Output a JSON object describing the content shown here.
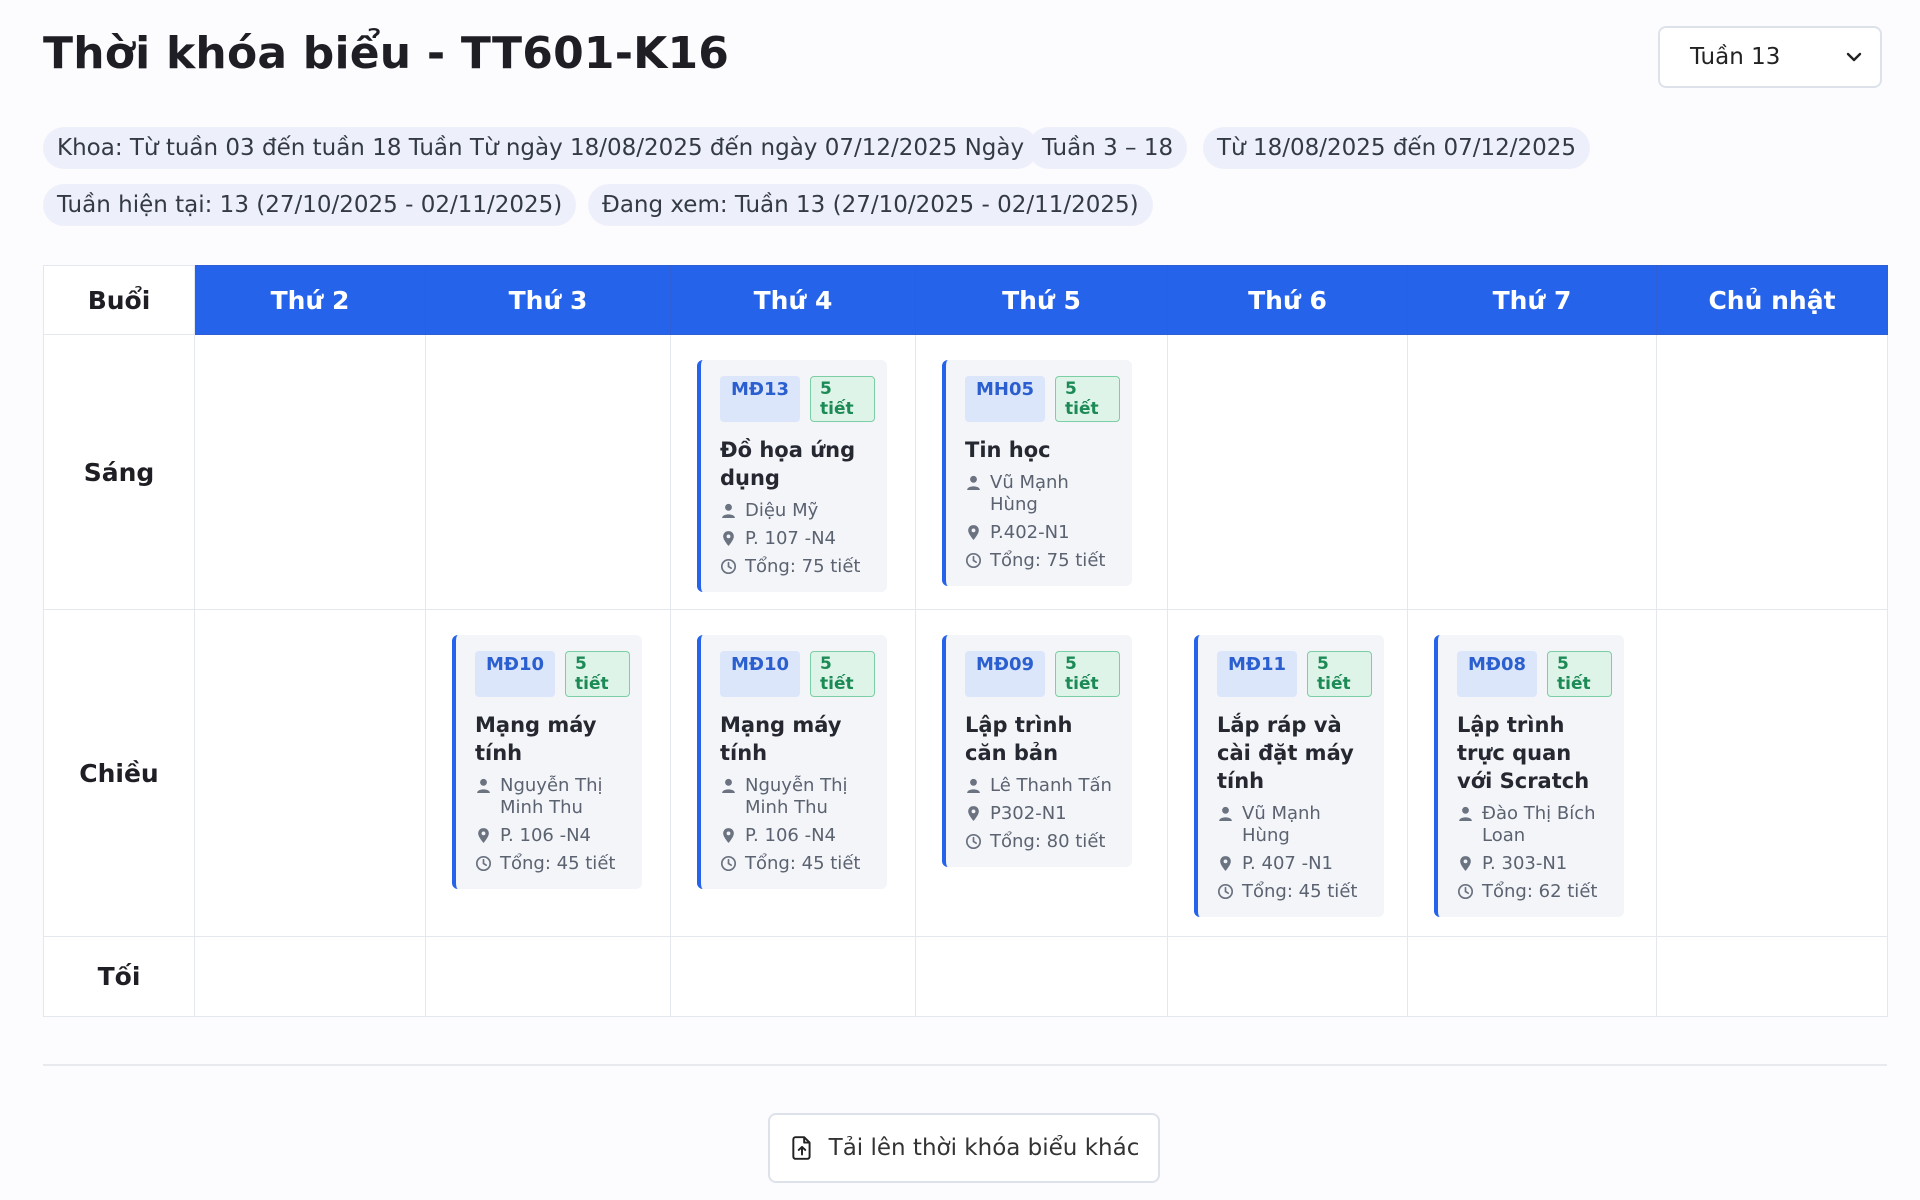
{
  "header": {
    "title": "Thời khóa biểu - TT601-K16",
    "week_select": "Tuần 13"
  },
  "info_pills": [
    "Khoa: Từ tuần 03 đến tuần 18 Tuần Từ ngày 18/08/2025 đến ngày 07/12/2025 Ngày",
    "Tuần 3 – 18",
    "Từ 18/08/2025 đến 07/12/2025",
    "Tuần hiện tại: 13 (27/10/2025 - 02/11/2025)",
    "Đang xem: Tuần 13 (27/10/2025 - 02/11/2025)"
  ],
  "table": {
    "corner": "Buổi",
    "days": [
      "Thứ 2",
      "Thứ 3",
      "Thứ 4",
      "Thứ 5",
      "Thứ 6",
      "Thứ 7",
      "Chủ nhật"
    ],
    "sessions": [
      "Sáng",
      "Chiều",
      "Tối"
    ]
  },
  "classes": {
    "sang_thu4": {
      "code": "MĐ13",
      "periods": "5 tiết",
      "name": "Đồ họa ứng dụng",
      "teacher": "Diệu Mỹ",
      "room": "P. 107 -N4",
      "total": "Tổng: 75 tiết"
    },
    "sang_thu5": {
      "code": "MH05",
      "periods": "5 tiết",
      "name": "Tin học",
      "teacher": "Vũ Mạnh Hùng",
      "room": "P.402-N1",
      "total": "Tổng: 75 tiết"
    },
    "chieu_thu3": {
      "code": "MĐ10",
      "periods": "5 tiết",
      "name": "Mạng máy tính",
      "teacher": "Nguyễn Thị Minh Thu",
      "room": "P. 106 -N4",
      "total": "Tổng: 45 tiết"
    },
    "chieu_thu4": {
      "code": "MĐ10",
      "periods": "5 tiết",
      "name": "Mạng máy tính",
      "teacher": "Nguyễn Thị Minh Thu",
      "room": "P. 106 -N4",
      "total": "Tổng: 45 tiết"
    },
    "chieu_thu5": {
      "code": "MĐ09",
      "periods": "5 tiết",
      "name": "Lập trình căn bản",
      "teacher": "Lê Thanh Tấn",
      "room": "P302-N1",
      "total": "Tổng: 80 tiết"
    },
    "chieu_thu6": {
      "code": "MĐ11",
      "periods": "5 tiết",
      "name": "Lắp ráp và cài đặt máy tính",
      "teacher": "Vũ Mạnh Hùng",
      "room": "P. 407 -N1",
      "total": "Tổng: 45 tiết"
    },
    "chieu_thu7": {
      "code": "MĐ08",
      "periods": "5 tiết",
      "name": "Lập trình trực quan với Scratch",
      "teacher": "Đào Thị Bích Loan",
      "room": "P. 303-N1",
      "total": "Tổng: 62 tiết"
    }
  },
  "footer": {
    "upload_label": "Tải lên thời khóa biểu khác"
  },
  "colors": {
    "accent": "#2563eb",
    "badge_green": "#1b8a55"
  }
}
